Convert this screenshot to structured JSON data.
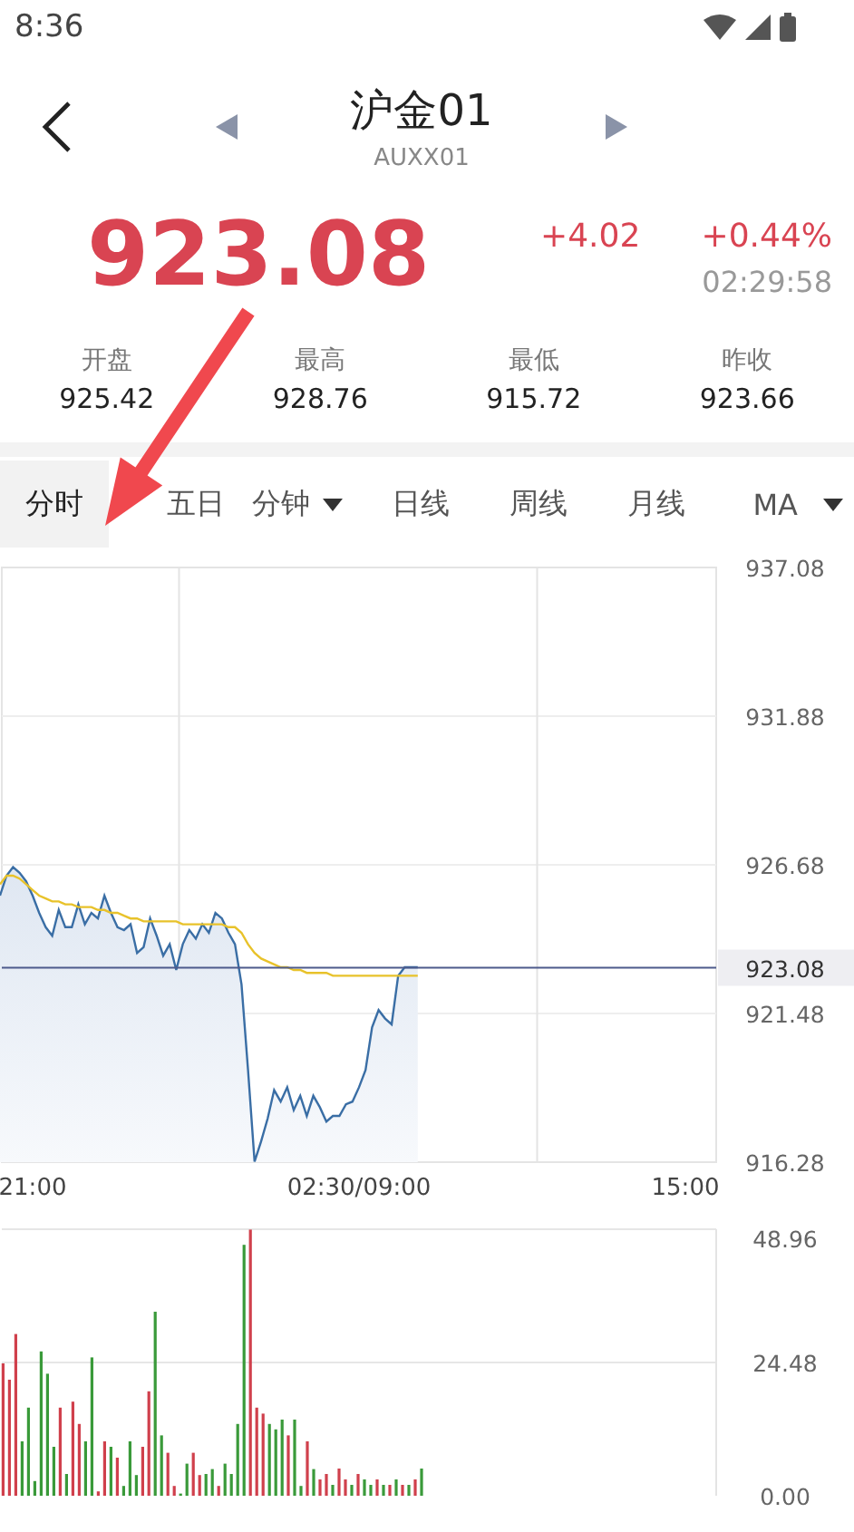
{
  "status_bar": {
    "time": "8:36"
  },
  "header": {
    "back": true,
    "title": "沪金01",
    "subtitle": "AUXX01",
    "prev": true,
    "next": true
  },
  "quote": {
    "price": "923.08",
    "change": "+4.02",
    "change_percent": "+0.44%",
    "time": "02:29:58"
  },
  "stats": [
    {
      "label": "开盘",
      "value": "925.42"
    },
    {
      "label": "最高",
      "value": "928.76"
    },
    {
      "label": "最低",
      "value": "915.72"
    },
    {
      "label": "昨收",
      "value": "923.66"
    }
  ],
  "tabs": [
    {
      "label": "分时",
      "kind": "plain",
      "selected": true
    },
    {
      "label": "五日",
      "kind": "plain",
      "selected": false
    },
    {
      "label": "分钟",
      "kind": "dropdown",
      "selected": false
    },
    {
      "label": "日线",
      "kind": "plain",
      "selected": false
    },
    {
      "label": "周线",
      "kind": "plain",
      "selected": false
    },
    {
      "label": "月线",
      "kind": "plain",
      "selected": false
    },
    {
      "label": "MA",
      "kind": "dropdown",
      "selected": false
    }
  ],
  "price_chart": {
    "chart_data": {
      "type": "area",
      "grid": true,
      "ylim": [
        916.28,
        937.08
      ],
      "yticks": [
        {
          "value": 937.08,
          "label": "937.08"
        },
        {
          "value": 931.88,
          "label": "931.88"
        },
        {
          "value": 926.68,
          "label": "926.68"
        },
        {
          "value": 921.48,
          "label": "921.48"
        },
        {
          "value": 916.28,
          "label": "916.28"
        }
      ],
      "categories": [
        null,
        null,
        null,
        null,
        null,
        "21:00",
        null,
        null,
        null,
        null,
        null,
        null,
        null,
        null,
        null,
        null,
        null,
        null,
        null,
        null,
        null,
        null,
        null,
        null,
        null,
        null,
        null,
        null,
        null,
        null,
        null,
        null,
        null,
        null,
        null,
        null,
        null,
        null,
        null,
        null,
        null,
        null,
        null,
        null,
        null,
        null,
        null,
        null,
        null,
        null,
        null,
        null,
        null,
        null,
        null,
        "02:30/09:00",
        null,
        null,
        null,
        null,
        null,
        null,
        null,
        null,
        null,
        null,
        null,
        null,
        null,
        null,
        null,
        null,
        null,
        null,
        null,
        null,
        null,
        null,
        null,
        null,
        null,
        null,
        null,
        null,
        null,
        null,
        null,
        null,
        null,
        null,
        null,
        null,
        null,
        null,
        null,
        null,
        null,
        null,
        null,
        null,
        null,
        null,
        null,
        null,
        null,
        "15:00"
      ],
      "series": [
        {
          "color": "#3a6ea5",
          "values": [
            925.6,
            926.3,
            926.6,
            926.4,
            926.1,
            925.6,
            925.0,
            924.5,
            924.2,
            925.1,
            924.5,
            924.5,
            925.3,
            924.6,
            925.0,
            924.8,
            925.6,
            925.0,
            924.5,
            924.4,
            924.6,
            923.6,
            923.8,
            924.8,
            924.2,
            923.5,
            923.9,
            923.0,
            923.9,
            924.4,
            924.1,
            924.6,
            924.3,
            925.0,
            924.8,
            924.3,
            923.9,
            922.5,
            919.5,
            916.3,
            917.0,
            917.8,
            918.8,
            918.4,
            918.9,
            918.1,
            918.6,
            917.9,
            918.6,
            918.2,
            917.7,
            917.9,
            917.9,
            918.3,
            918.4,
            918.9,
            919.5,
            921.0,
            921.6,
            921.3,
            921.1,
            922.8,
            923.1,
            923.1,
            923.1,
            null,
            null,
            null,
            null,
            null,
            null,
            null,
            null,
            null,
            null,
            null,
            null,
            null,
            null,
            null,
            null,
            null,
            null,
            null,
            null,
            null,
            null,
            null,
            null,
            null,
            null,
            null,
            null,
            null,
            null,
            null,
            null,
            null,
            null,
            null,
            null,
            null,
            null,
            null,
            null,
            null
          ]
        },
        {
          "type": "line",
          "color": "#e8c22a",
          "values": [
            926.0,
            926.3,
            926.3,
            926.2,
            926.0,
            925.8,
            925.6,
            925.5,
            925.4,
            925.4,
            925.3,
            925.3,
            925.2,
            925.2,
            925.2,
            925.1,
            925.1,
            925.0,
            925.0,
            924.9,
            924.8,
            924.8,
            924.7,
            924.7,
            924.7,
            924.7,
            924.7,
            924.7,
            924.6,
            924.6,
            924.6,
            924.6,
            924.6,
            924.6,
            924.6,
            924.5,
            924.5,
            924.3,
            923.9,
            923.6,
            923.4,
            923.3,
            923.2,
            923.1,
            923.1,
            923.0,
            923.0,
            922.9,
            922.9,
            922.9,
            922.9,
            922.8,
            922.8,
            922.8,
            922.8,
            922.8,
            922.8,
            922.8,
            922.8,
            922.8,
            922.8,
            922.8,
            922.8,
            922.8,
            922.8,
            null,
            null,
            null,
            null,
            null,
            null,
            null,
            null,
            null,
            null,
            null,
            null,
            null,
            null,
            null,
            null,
            null,
            null,
            null,
            null,
            null,
            null,
            null,
            null,
            null,
            null,
            null,
            null,
            null,
            null,
            null,
            null,
            null,
            null,
            null,
            null,
            null,
            null,
            null,
            null,
            null
          ]
        }
      ],
      "ref_lines": [
        {
          "axis": "y",
          "value": 923.08,
          "label": "923.08"
        }
      ]
    }
  },
  "volume_chart": {
    "chart_data": {
      "type": "bar",
      "grid": true,
      "ylim": [
        0,
        48.96
      ],
      "yticks": [
        {
          "value": 48.96,
          "label": "48.96"
        },
        {
          "value": 24.48,
          "label": "24.48"
        },
        {
          "value": 0,
          "label": "0.00"
        }
      ],
      "categories": [
        null,
        null,
        null,
        null,
        null,
        null,
        null,
        null,
        null,
        null,
        null,
        null,
        null,
        null,
        null,
        null,
        null,
        null,
        null,
        null,
        null,
        null,
        null,
        null,
        null,
        null,
        null,
        null,
        null,
        null,
        null,
        null,
        null,
        null,
        null,
        null,
        null,
        null,
        null,
        null,
        null,
        null,
        null,
        null,
        null,
        null,
        null,
        null,
        null,
        null,
        null,
        null,
        null,
        null,
        null,
        null,
        null,
        null,
        null,
        null,
        null,
        null,
        null,
        null,
        null,
        null,
        null,
        null,
        null,
        null,
        null,
        null,
        null,
        null,
        null,
        null,
        null,
        null,
        null,
        null,
        null,
        null,
        null,
        null,
        null,
        null,
        null,
        null,
        null,
        null,
        null,
        null,
        null,
        null,
        null,
        null,
        null,
        null,
        null,
        null,
        null,
        null,
        null,
        null,
        null,
        null,
        null,
        null,
        null,
        null,
        null,
        null,
        null
      ],
      "series": [
        {
          "color": "#d0404c",
          "values": [
            24.3,
            21.3,
            29.7,
            null,
            null,
            null,
            null,
            null,
            null,
            16.2,
            null,
            17.3,
            13.2,
            null,
            null,
            0.8,
            10,
            null,
            7,
            null,
            null,
            null,
            9,
            19.2,
            null,
            null,
            7.9,
            1.8,
            null,
            null,
            7.9,
            3.8,
            null,
            null,
            1.8,
            null,
            null,
            null,
            null,
            48.9,
            16.2,
            15.1,
            null,
            null,
            null,
            11.1,
            null,
            null,
            10,
            null,
            3,
            4,
            null,
            5,
            3,
            null,
            4,
            null,
            null,
            3,
            null,
            2,
            null,
            2,
            null,
            3,
            null,
            null,
            null,
            null,
            null,
            null,
            null,
            null,
            null,
            null,
            null,
            null,
            null,
            null,
            null,
            null,
            null,
            null,
            null,
            null,
            null,
            null,
            null,
            null,
            null,
            null,
            null,
            null,
            null,
            null,
            null,
            null,
            null,
            null,
            null,
            null,
            null,
            null,
            null,
            null,
            null,
            null,
            null,
            null,
            null,
            null,
            null
          ]
        },
        {
          "color": "#3a9a3a",
          "values": [
            null,
            null,
            null,
            10,
            16.2,
            2.7,
            26.5,
            22.4,
            9,
            null,
            4,
            null,
            null,
            10,
            25.4,
            null,
            null,
            9,
            null,
            1.8,
            10,
            3.8,
            null,
            null,
            33.8,
            11.1,
            null,
            null,
            0.4,
            5.9,
            null,
            null,
            4,
            4.9,
            null,
            5.9,
            4,
            13.2,
            46.1,
            null,
            null,
            null,
            13.2,
            12.2,
            14,
            null,
            14,
            1.8,
            null,
            4.9,
            null,
            null,
            2,
            null,
            null,
            2,
            null,
            3,
            2,
            null,
            2,
            null,
            3,
            null,
            2,
            null,
            5,
            null,
            null,
            null,
            null,
            null,
            null,
            null,
            null,
            null,
            null,
            null,
            null,
            null,
            null,
            null,
            null,
            null,
            null,
            null,
            null,
            null,
            null,
            null,
            null,
            null,
            null,
            null,
            null,
            null,
            null,
            null,
            null,
            null,
            null,
            null,
            null,
            null,
            null,
            null,
            null,
            null,
            null,
            null,
            null,
            null,
            null
          ]
        }
      ]
    }
  }
}
